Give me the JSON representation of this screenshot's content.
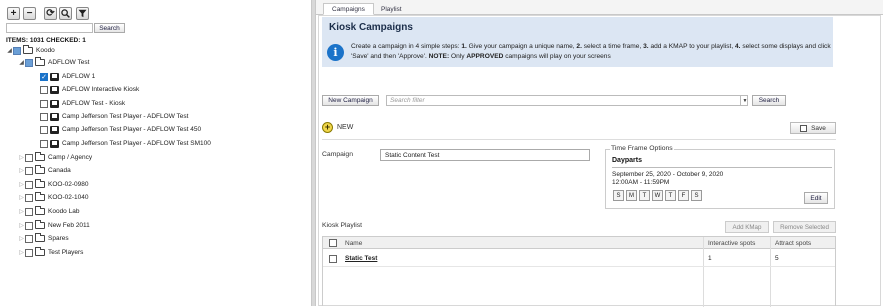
{
  "left": {
    "toolbar": {
      "add_icon": "plus-icon",
      "remove_icon": "minus-icon",
      "refresh_icon": "refresh-icon",
      "zoom_icon": "magnifier-icon",
      "filter_icon": "filter-icon"
    },
    "search": {
      "placeholder": "",
      "button_label": "Search"
    },
    "counts": "ITEMS: 1031    CHECKED: 1",
    "tree": [
      {
        "label": "Koodo",
        "level": 0,
        "type": "folder",
        "state": "partial",
        "expanded": true
      },
      {
        "label": "ADFLOW Test",
        "level": 1,
        "type": "folder",
        "state": "partial",
        "expanded": true
      },
      {
        "label": "ADFLOW 1",
        "level": 2,
        "type": "kiosk",
        "state": "checked"
      },
      {
        "label": "ADFLOW Interactive Kiosk",
        "level": 2,
        "type": "kiosk",
        "state": "unchecked"
      },
      {
        "label": "ADFLOW Test - Kiosk",
        "level": 2,
        "type": "kiosk",
        "state": "unchecked"
      },
      {
        "label": "Camp Jefferson Test Player - ADFLOW Test",
        "level": 2,
        "type": "kiosk",
        "state": "unchecked"
      },
      {
        "label": "Camp Jefferson Test Player - ADFLOW Test 450",
        "level": 2,
        "type": "kiosk",
        "state": "unchecked"
      },
      {
        "label": "Camp Jefferson Test Player - ADFLOW Test SM100",
        "level": 2,
        "type": "kiosk",
        "state": "unchecked"
      },
      {
        "label": "Camp / Agency",
        "level": 1,
        "type": "folder",
        "state": "unchecked",
        "expanded": false
      },
      {
        "label": "Canada",
        "level": 1,
        "type": "folder",
        "state": "unchecked",
        "expanded": false
      },
      {
        "label": "KOO-02-0980",
        "level": 1,
        "type": "folder",
        "state": "unchecked",
        "expanded": false
      },
      {
        "label": "KOO-02-1040",
        "level": 1,
        "type": "folder",
        "state": "unchecked",
        "expanded": false
      },
      {
        "label": "Koodo Lab",
        "level": 1,
        "type": "folder",
        "state": "unchecked",
        "expanded": false
      },
      {
        "label": "New Feb 2011",
        "level": 1,
        "type": "folder",
        "state": "unchecked",
        "expanded": false
      },
      {
        "label": "Spares",
        "level": 1,
        "type": "folder",
        "state": "unchecked",
        "expanded": false
      },
      {
        "label": "Test Players",
        "level": 1,
        "type": "folder",
        "state": "unchecked",
        "expanded": false
      }
    ]
  },
  "tabs": [
    {
      "label": "Campaigns",
      "active": true
    },
    {
      "label": "Playlist",
      "active": false
    }
  ],
  "main": {
    "title": "Kiosk Campaigns",
    "info": {
      "icon": "info-icon",
      "p1": "Create a campaign in 4 simple steps: ",
      "s1": "1.",
      "p2": " Give your campaign a unique name, ",
      "s2": "2.",
      "p3": " select a time frame, ",
      "s3": "3.",
      "p4": " add a KMAP to your playlist, ",
      "s4": "4.",
      "p5": " select some displays and click 'Save' and then 'Approve'. ",
      "s5": "NOTE:",
      "p6": " Only ",
      "s6": "APPROVED",
      "p7": " campaigns will play on your screens"
    },
    "new_campaign_label": "New Campaign",
    "filter_placeholder": "Search filter",
    "filter_search_label": "Search",
    "new_label": "NEW",
    "save_label": "Save",
    "campaign_label": "Campaign",
    "campaign_name": "Static Content Test",
    "timeframe": {
      "legend": "Time Frame Options",
      "dayparts": "Dayparts",
      "dates": "September 25, 2020 - October 9, 2020",
      "times": "12:00AM - 11:59PM",
      "days": [
        "S",
        "M",
        "T",
        "W",
        "T",
        "F",
        "S"
      ],
      "edit_label": "Edit"
    },
    "playlist": {
      "label": "Kiosk Playlist",
      "add_kmap_label": "Add KMap",
      "remove_label": "Remove Selected",
      "columns": [
        "Name",
        "Interactive spots",
        "Attract spots"
      ],
      "rows": [
        {
          "name": "Static Test",
          "interactive": "1",
          "attract": "5"
        }
      ]
    }
  }
}
